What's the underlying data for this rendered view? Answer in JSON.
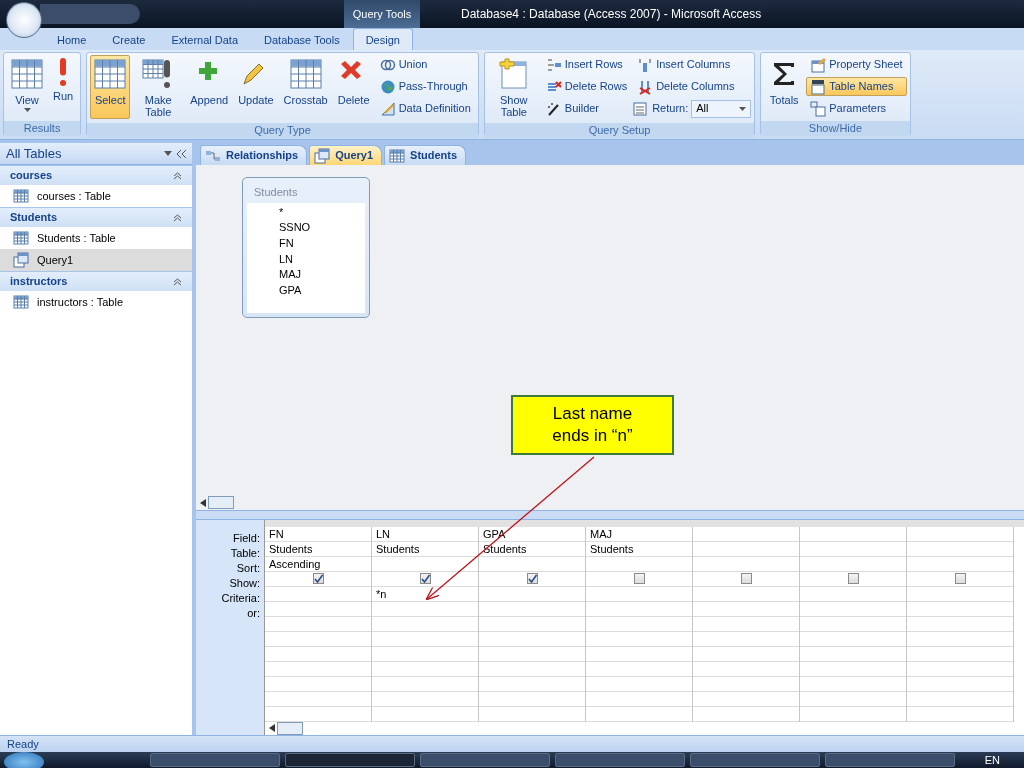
{
  "title_bar": {
    "context_tab": "Query Tools",
    "title": "Database4 : Database (Access 2007)  -  Microsoft Access"
  },
  "ribbon_tabs": [
    {
      "label": "Home",
      "selected": false
    },
    {
      "label": "Create",
      "selected": false
    },
    {
      "label": "External Data",
      "selected": false
    },
    {
      "label": "Database Tools",
      "selected": false
    },
    {
      "label": "Design",
      "selected": true
    }
  ],
  "ribbon_groups": [
    {
      "label": "Results",
      "items": [
        {
          "kind": "large",
          "label": "View",
          "selected": false,
          "menu": true
        },
        {
          "kind": "large",
          "label": "Run",
          "selected": false
        }
      ]
    },
    {
      "label": "Query Type",
      "items": [
        {
          "kind": "large",
          "label": "Select",
          "selected": true
        },
        {
          "kind": "large",
          "label": "Make Table",
          "selected": false
        },
        {
          "kind": "large",
          "label": "Append",
          "selected": false
        },
        {
          "kind": "large",
          "label": "Update",
          "selected": false
        },
        {
          "kind": "large",
          "label": "Crosstab",
          "selected": false
        },
        {
          "kind": "large",
          "label": "Delete",
          "selected": false
        },
        {
          "kind": "small",
          "label": "Union",
          "selected": false
        },
        {
          "kind": "small",
          "label": "Pass-Through",
          "selected": false
        },
        {
          "kind": "small",
          "label": "Data Definition",
          "selected": false
        }
      ]
    },
    {
      "label": "Query Setup",
      "items": [
        {
          "kind": "large",
          "label": "Show Table",
          "selected": false
        },
        {
          "kind": "small",
          "label": "Insert Rows",
          "selected": false
        },
        {
          "kind": "small",
          "label": "Delete Rows",
          "selected": false
        },
        {
          "kind": "small",
          "label": "Builder",
          "selected": false
        },
        {
          "kind": "small",
          "label": "Insert Columns",
          "selected": false
        },
        {
          "kind": "small",
          "label": "Delete Columns",
          "selected": false
        },
        {
          "kind": "dropdown",
          "label": "Return:",
          "value": "All"
        }
      ]
    },
    {
      "label": "Show/Hide",
      "items": [
        {
          "kind": "large",
          "label": "Totals",
          "selected": false
        },
        {
          "kind": "small",
          "label": "Property Sheet",
          "selected": false
        },
        {
          "kind": "small",
          "label": "Table Names",
          "selected": true
        },
        {
          "kind": "small",
          "label": "Parameters",
          "selected": false
        }
      ]
    }
  ],
  "nav_pane": {
    "title": "All Tables",
    "groups": [
      {
        "label": "courses",
        "items": [
          {
            "label": "courses : Table",
            "kind": "table",
            "selected": false
          }
        ]
      },
      {
        "label": "Students",
        "items": [
          {
            "label": "Students : Table",
            "kind": "table",
            "selected": false
          },
          {
            "label": "Query1",
            "kind": "query",
            "selected": true
          }
        ]
      },
      {
        "label": "instructors",
        "items": [
          {
            "label": "instructors : Table",
            "kind": "table",
            "selected": false
          }
        ]
      }
    ]
  },
  "doc_tabs": [
    {
      "label": "Relationships",
      "kind": "relationships",
      "selected": false
    },
    {
      "label": "Query1",
      "kind": "query",
      "selected": true
    },
    {
      "label": "Students",
      "kind": "table",
      "selected": false
    }
  ],
  "table_box": {
    "title": "Students",
    "fields": [
      "*",
      "SSNO",
      "FN",
      "LN",
      "MAJ",
      "GPA"
    ]
  },
  "callout": {
    "text": "Last name ends in “n”"
  },
  "grid": {
    "row_labels": [
      "Field:",
      "Table:",
      "Sort:",
      "Show:",
      "Criteria:",
      "or:"
    ],
    "columns": [
      {
        "field": "FN",
        "table": "Students",
        "sort": "Ascending",
        "show": true
      },
      {
        "field": "LN",
        "table": "Students",
        "show": true,
        "criteria": "*n"
      },
      {
        "field": "GPA",
        "table": "Students",
        "show": true
      },
      {
        "field": "MAJ",
        "table": "Students",
        "show": false
      },
      {
        "show": false
      },
      {
        "show": false
      },
      {
        "show": false
      }
    ]
  },
  "status_bar": {
    "text": "Ready"
  },
  "taskbar": {
    "windows": [
      {
        "selected": false
      },
      {
        "selected": true
      },
      {
        "selected": false
      },
      {
        "selected": false
      },
      {
        "selected": false
      },
      {
        "selected": false
      }
    ],
    "language": "EN"
  }
}
